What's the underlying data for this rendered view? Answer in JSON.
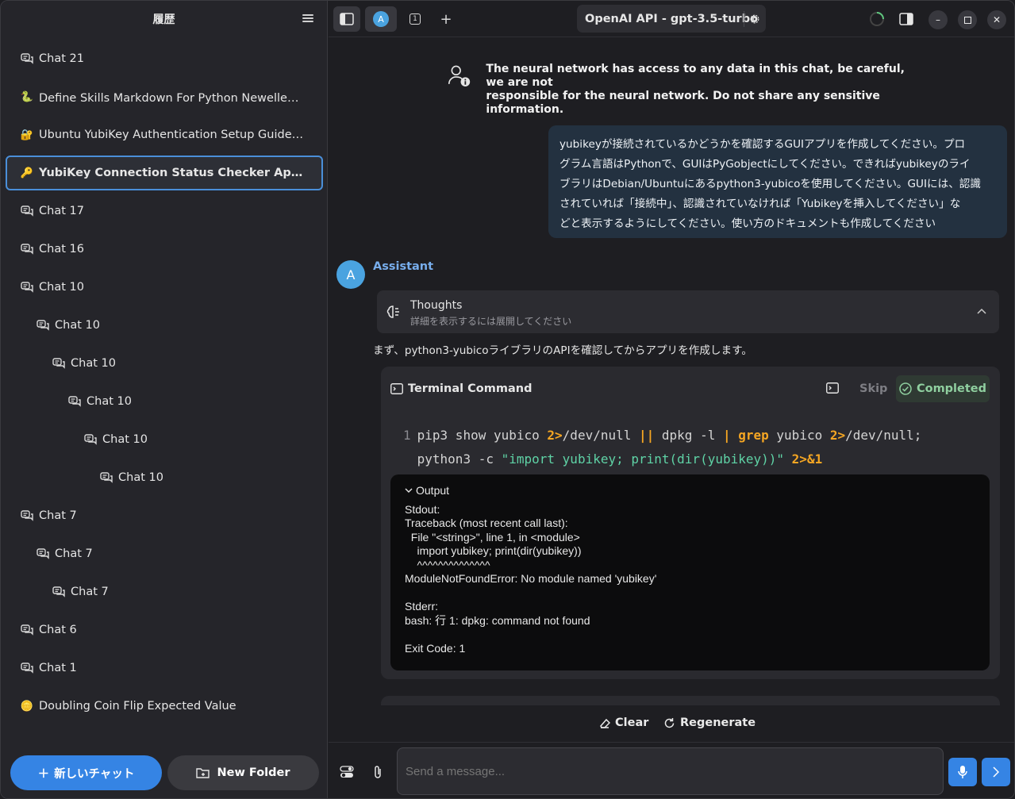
{
  "sidebar": {
    "title": "履歴",
    "items": [
      {
        "label": "Chat 21",
        "icon": "chat-bubbles-icon",
        "indent": 0
      },
      {
        "label": "Define Skills Markdown For Python Newelle（お...",
        "icon": "snake-emoji-icon",
        "indent": 0
      },
      {
        "label": "Ubuntu YubiKey Authentication Setup Guide Ub...",
        "icon": "lock-key-emoji-icon",
        "indent": 0
      },
      {
        "label": "YubiKey Connection Status Checker App pytho...",
        "icon": "key-emoji-icon",
        "indent": 0,
        "selected": true
      },
      {
        "label": "Chat 17",
        "icon": "chat-bubbles-icon",
        "indent": 0
      },
      {
        "label": "Chat 16",
        "icon": "chat-bubbles-icon",
        "indent": 0
      },
      {
        "label": "Chat 10",
        "icon": "chat-bubbles-icon",
        "indent": 0
      },
      {
        "label": "Chat 10",
        "icon": "chat-bubbles-icon",
        "indent": 1
      },
      {
        "label": "Chat 10",
        "icon": "chat-bubbles-icon",
        "indent": 2
      },
      {
        "label": "Chat 10",
        "icon": "chat-bubbles-icon",
        "indent": 3
      },
      {
        "label": "Chat 10",
        "icon": "chat-bubbles-icon",
        "indent": 4
      },
      {
        "label": "Chat 10",
        "icon": "chat-bubbles-icon",
        "indent": 5
      },
      {
        "label": "Chat 7",
        "icon": "chat-bubbles-icon",
        "indent": 0
      },
      {
        "label": "Chat 7",
        "icon": "chat-bubbles-icon",
        "indent": 1
      },
      {
        "label": "Chat 7",
        "icon": "chat-bubbles-icon",
        "indent": 2
      },
      {
        "label": "Chat 6",
        "icon": "chat-bubbles-icon",
        "indent": 0
      },
      {
        "label": "Chat 1",
        "icon": "chat-bubbles-icon",
        "indent": 0
      },
      {
        "label": "Doubling Coin Flip Expected Value",
        "icon": "coin-emoji-icon",
        "indent": 0
      }
    ],
    "new_chat_label": "新しいチャット",
    "new_folder_label": "New Folder"
  },
  "topbar": {
    "tab_avatar_letter": "A",
    "tab_count": "1",
    "model_label": "OpenAI API - gpt-3.5-turbo"
  },
  "notice": {
    "line1": "The neural network has access to any data in this chat, be careful, we are not",
    "line2": "responsible for the neural network. Do not share any sensitive information."
  },
  "user_message": {
    "lines": [
      "yubikeyが接続されているかどうかを確認するGUIアプリを作成してください。プロ",
      "グラム言語はPythonで、GUIはPyGobjectにしてください。できればyubikeyのライ",
      "ブラリはDebian/Ubuntuにあるpython3-yubicoを使用してください。GUIには、認識",
      "されていれば「接続中」、認識されていなければ「Yubikeyを挿入してください」な",
      "どと表示するようにしてください。使い方のドキュメントも作成してください"
    ]
  },
  "assistant": {
    "avatar_letter": "A",
    "name": "Assistant",
    "thoughts_title": "Thoughts",
    "thoughts_subtitle": "詳細を表示するには展開してください",
    "intro": "まず、python3-yubicoライブラリのAPIを確認してからアプリを作成します。"
  },
  "terminal": {
    "title": "Terminal Command",
    "skip_label": "Skip",
    "status_label": "Completed",
    "line_number": "1",
    "code_line1_parts": [
      "pip3 show yubico ",
      "2>",
      "/dev/null ",
      "||",
      " dpkg -l ",
      "|",
      " ",
      "grep",
      " yubico ",
      "2>",
      "/dev/null;"
    ],
    "code_line2_parts": [
      "python3 -c ",
      "\"import yubikey; print(dir(yubikey))\"",
      " ",
      "2>&1"
    ],
    "output_title": "Output",
    "output_text": "Stdout:\nTraceback (most recent call last):\n  File \"<string>\", line 1, in <module>\n    import yubikey; print(dir(yubikey))\n    ^^^^^^^^^^^^^^\nModuleNotFoundError: No module named 'yubikey'\n\nStderr:\nbash: 行 1: dpkg: command not found\n\nExit Code: 1"
  },
  "actions": {
    "clear_label": "Clear",
    "regenerate_label": "Regenerate"
  },
  "composer": {
    "placeholder": "Send a message..."
  },
  "colors": {
    "accent": "#3584e4",
    "assistant_name": "#78aeed",
    "completed": "#8fcf9f",
    "code_operator": "#f5a623",
    "code_string": "#5fd3a6"
  }
}
